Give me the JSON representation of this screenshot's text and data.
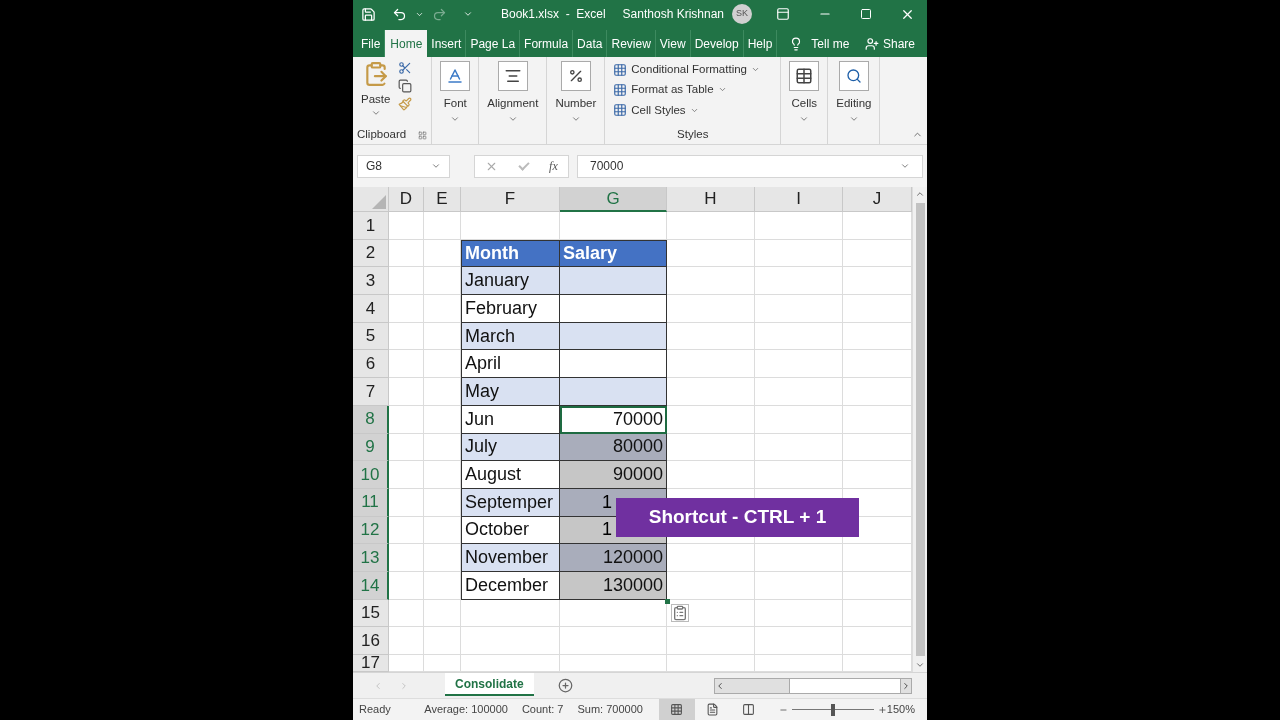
{
  "title_bar": {
    "title": "Book1.xlsx  -  Excel",
    "user": "Santhosh Krishnan",
    "avatar": "SK"
  },
  "ribbon_tabs": [
    {
      "label": "File",
      "selected": false
    },
    {
      "label": "Home",
      "selected": true
    },
    {
      "label": "Insert",
      "selected": false
    },
    {
      "label": "Page La",
      "selected": false
    },
    {
      "label": "Formula",
      "selected": false
    },
    {
      "label": "Data",
      "selected": false
    },
    {
      "label": "Review",
      "selected": false
    },
    {
      "label": "View",
      "selected": false
    },
    {
      "label": "Develop",
      "selected": false
    },
    {
      "label": "Help",
      "selected": false
    }
  ],
  "tell_me": "Tell me",
  "share": "Share",
  "clipboard": {
    "paste": "Paste",
    "label": "Clipboard"
  },
  "big_buttons": [
    {
      "kind": "font",
      "label": "Font"
    },
    {
      "kind": "alignment",
      "label": "Alignment"
    },
    {
      "kind": "number",
      "label": "Number"
    }
  ],
  "styles": {
    "items": [
      "Conditional Formatting",
      "Format as Table",
      "Cell Styles"
    ],
    "label": "Styles"
  },
  "right_buttons": [
    {
      "kind": "cells",
      "label": "Cells"
    },
    {
      "kind": "editing",
      "label": "Editing"
    }
  ],
  "name_box": "G8",
  "function_label": "fx",
  "formula": "70000",
  "columns": [
    {
      "label": "D",
      "selected": false
    },
    {
      "label": "E",
      "selected": false
    },
    {
      "label": "F",
      "selected": false
    },
    {
      "label": "G",
      "selected": true
    },
    {
      "label": "H",
      "selected": false
    },
    {
      "label": "I",
      "selected": false
    },
    {
      "label": "J",
      "selected": false
    }
  ],
  "rows": [
    {
      "number": "1",
      "kind": "empty",
      "selected": false,
      "active": false
    },
    {
      "number": "2",
      "kind": "header",
      "selected": false,
      "active": false,
      "month": "Month",
      "salary": {
        "text": "Salary",
        "covered": false
      }
    },
    {
      "number": "3",
      "kind": "band",
      "selected": false,
      "active": false,
      "month": "January"
    },
    {
      "number": "4",
      "kind": "plain",
      "selected": false,
      "active": false,
      "month": "February"
    },
    {
      "number": "5",
      "kind": "band",
      "selected": false,
      "active": false,
      "month": "March"
    },
    {
      "number": "6",
      "kind": "plain",
      "selected": false,
      "active": false,
      "month": "April"
    },
    {
      "number": "7",
      "kind": "band",
      "selected": false,
      "active": false,
      "month": "May"
    },
    {
      "number": "8",
      "kind": "plain",
      "selected": true,
      "active": true,
      "month": "Jun",
      "salary": {
        "text": "70000",
        "covered": false
      }
    },
    {
      "number": "9",
      "kind": "band",
      "selected": true,
      "active": false,
      "month": "July",
      "salary": {
        "text": "80000",
        "covered": false
      }
    },
    {
      "number": "10",
      "kind": "plain",
      "selected": true,
      "active": false,
      "month": "August",
      "salary": {
        "text": "90000",
        "covered": false
      }
    },
    {
      "number": "11",
      "kind": "band",
      "selected": true,
      "active": false,
      "month": "Septemper",
      "salary": {
        "text": "1",
        "covered": true
      }
    },
    {
      "number": "12",
      "kind": "plain",
      "selected": true,
      "active": false,
      "month": "October",
      "salary": {
        "text": "1",
        "covered": true
      }
    },
    {
      "number": "13",
      "kind": "band",
      "selected": true,
      "active": false,
      "month": "November",
      "salary": {
        "text": "120000",
        "covered": false
      }
    },
    {
      "number": "14",
      "kind": "plain",
      "selected": true,
      "active": false,
      "month": "December",
      "salary": {
        "text": "130000",
        "covered": false
      }
    },
    {
      "number": "15",
      "kind": "empty",
      "selected": false,
      "active": false
    },
    {
      "number": "16",
      "kind": "empty",
      "selected": false,
      "active": false
    },
    {
      "number": "17",
      "kind": "empty",
      "selected": false,
      "active": false
    }
  ],
  "overlay": {
    "text": "Shortcut - CTRL + 1"
  },
  "sheet_tabs": [
    {
      "label": "Consolidate",
      "selected": true
    }
  ],
  "status_bar": {
    "ready": "Ready",
    "average": "Average: 100000",
    "count": "Count: 7",
    "sum": "Sum: 700000",
    "views": [
      {
        "kind": "normal",
        "selected": true
      },
      {
        "kind": "page_layout",
        "selected": false
      },
      {
        "kind": "page_break",
        "selected": false
      }
    ],
    "zoom": {
      "level": 0.5
    },
    "zoom_text": "150%"
  }
}
